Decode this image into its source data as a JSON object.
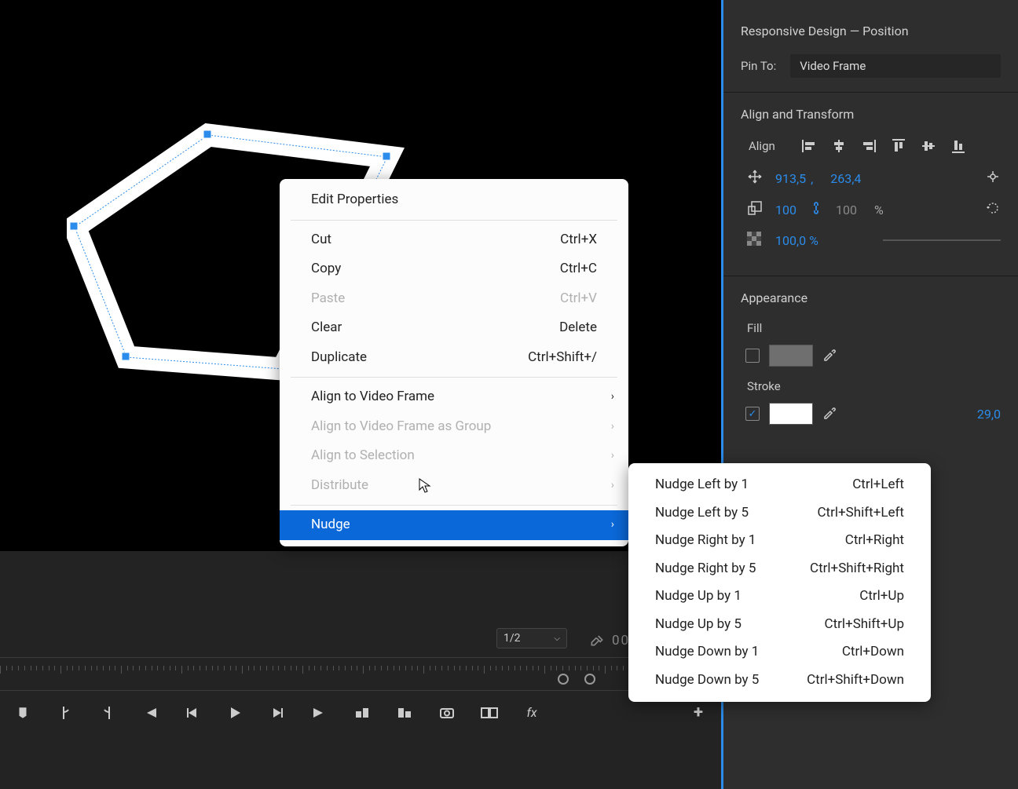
{
  "panel": {
    "responsive_heading": "Responsive Design — Position",
    "pin_to_label": "Pin To:",
    "pin_to_value": "Video Frame",
    "align_heading": "Align and Transform",
    "align_label": "Align",
    "position_x": "913,5",
    "position_sep": ",",
    "position_y": "263,4",
    "scale_w": "100",
    "scale_h": "100",
    "scale_unit": "%",
    "opacity": "100,0 %",
    "appearance_heading": "Appearance",
    "fill_label": "Fill",
    "fill_color": "#6f6f6f",
    "stroke_label": "Stroke",
    "stroke_color": "#ffffff",
    "stroke_width": "29,0"
  },
  "viewport": {
    "resolution": "1/2",
    "timecode_partial": "00"
  },
  "context_menu": {
    "edit_properties": "Edit Properties",
    "cut": "Cut",
    "cut_sc": "Ctrl+X",
    "copy": "Copy",
    "copy_sc": "Ctrl+C",
    "paste": "Paste",
    "paste_sc": "Ctrl+V",
    "clear": "Clear",
    "clear_sc": "Delete",
    "duplicate": "Duplicate",
    "duplicate_sc": "Ctrl+Shift+/",
    "align_video": "Align to Video Frame",
    "align_video_group": "Align to Video Frame as Group",
    "align_selection": "Align to Selection",
    "distribute": "Distribute",
    "nudge": "Nudge"
  },
  "nudge_submenu": [
    {
      "label": "Nudge Left by 1",
      "sc": "Ctrl+Left"
    },
    {
      "label": "Nudge Left by 5",
      "sc": "Ctrl+Shift+Left"
    },
    {
      "label": "Nudge Right by 1",
      "sc": "Ctrl+Right"
    },
    {
      "label": "Nudge Right by 5",
      "sc": "Ctrl+Shift+Right"
    },
    {
      "label": "Nudge Up by 1",
      "sc": "Ctrl+Up"
    },
    {
      "label": "Nudge Up by 5",
      "sc": "Ctrl+Shift+Up"
    },
    {
      "label": "Nudge Down by 1",
      "sc": "Ctrl+Down"
    },
    {
      "label": "Nudge Down by 5",
      "sc": "Ctrl+Shift+Down"
    }
  ]
}
